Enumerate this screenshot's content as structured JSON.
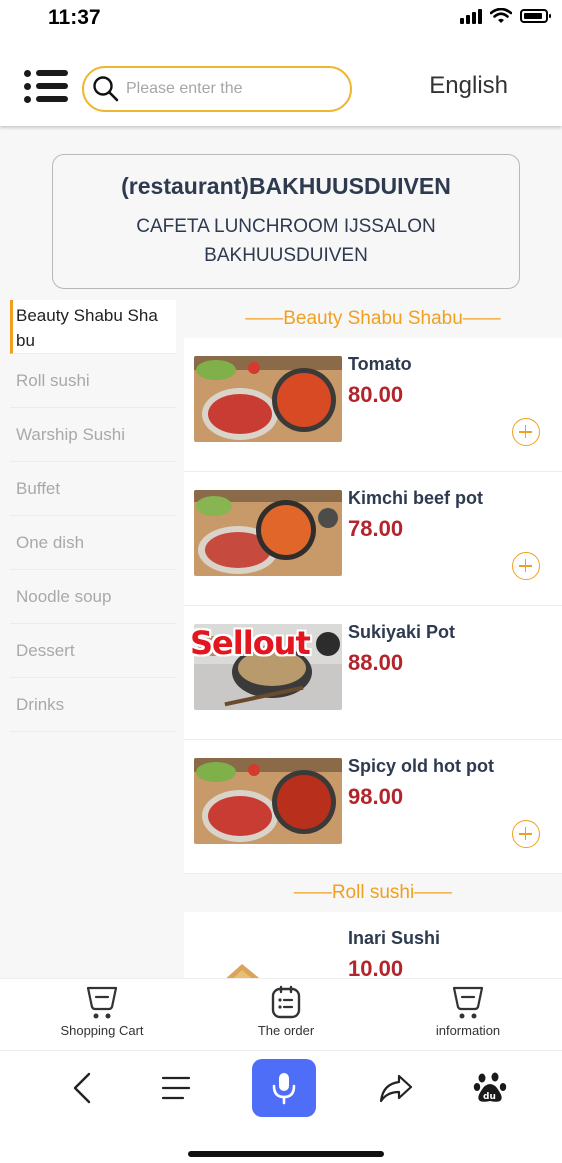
{
  "status": {
    "time": "11:37"
  },
  "header": {
    "search_placeholder": "Please enter the",
    "language": "English"
  },
  "restaurant": {
    "name": "(restaurant)BAKHUUSDUIVEN",
    "subtitle": "CAFETA LUNCHROOM IJSSALON BAKHUUSDUIVEN"
  },
  "categories": [
    {
      "label": "Beauty Shabu Sha bu",
      "active": true
    },
    {
      "label": "Roll sushi"
    },
    {
      "label": "Warship Sushi"
    },
    {
      "label": "Buffet"
    },
    {
      "label": "One dish"
    },
    {
      "label": "Noodle soup"
    },
    {
      "label": "Dessert"
    },
    {
      "label": "Drinks"
    }
  ],
  "sections": [
    {
      "title": "——Beauty Shabu Shabu——",
      "products": [
        {
          "name": "Tomato",
          "price": "80.00",
          "image": "hot-pot-tomato"
        },
        {
          "name": "Kimchi beef pot",
          "price": "78.00",
          "image": "hot-pot-kimchi"
        },
        {
          "name": "Sukiyaki Pot",
          "price": "88.00",
          "image": "hot-pot-sukiyaki",
          "badge": "Sellout"
        },
        {
          "name": "Spicy old hot pot",
          "price": "98.00",
          "image": "hot-pot-spicy"
        }
      ]
    },
    {
      "title": "——Roll sushi——",
      "products": [
        {
          "name": "Inari Sushi",
          "price": "10.00",
          "image": "inari-sushi"
        }
      ]
    }
  ],
  "tabbar": {
    "cart": "Shopping Cart",
    "order": "The order",
    "info": "information"
  },
  "colors": {
    "accent": "#f0a020",
    "price": "#b3242b",
    "sellout": "#e3151f",
    "voice": "#4f6ef7",
    "search_border": "#f0b632"
  }
}
